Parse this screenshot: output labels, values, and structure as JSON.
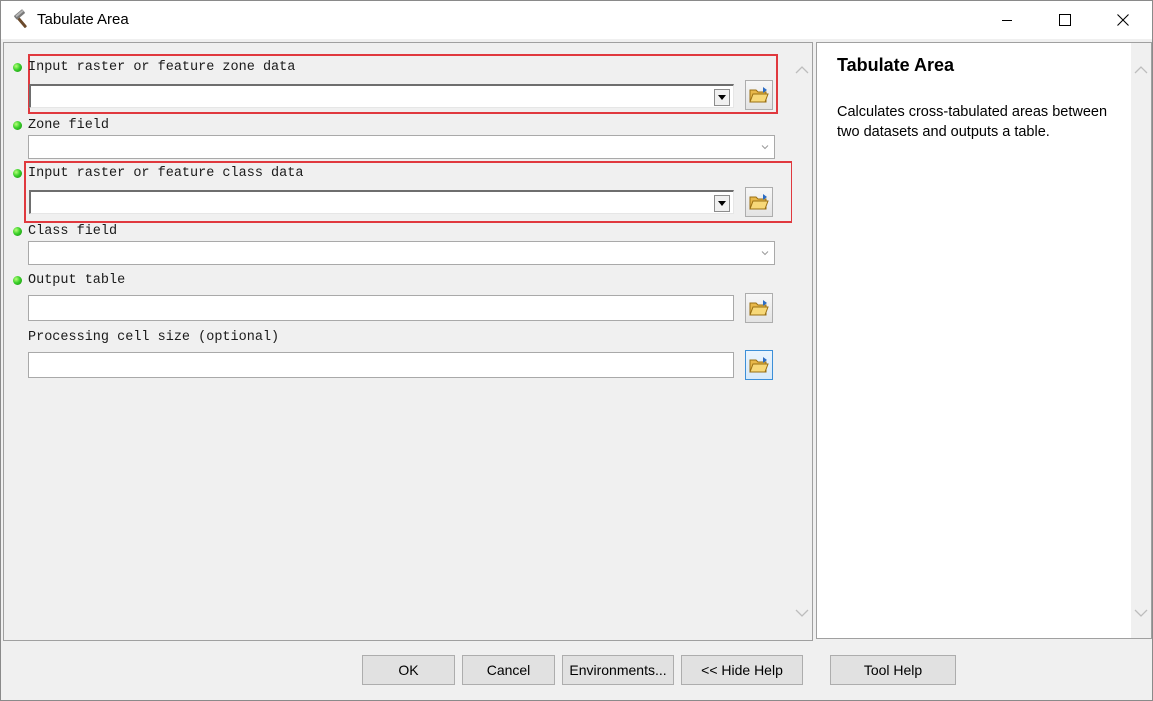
{
  "window": {
    "title": "Tabulate Area",
    "controls": [
      "minimize-icon",
      "maximize-icon",
      "close-icon"
    ]
  },
  "params": {
    "zone_data": {
      "label": "Input raster or feature zone data",
      "value": "",
      "required": true
    },
    "zone_field": {
      "label": "Zone field",
      "value": "",
      "required": true
    },
    "class_data": {
      "label": "Input raster or feature class data",
      "value": "",
      "required": true
    },
    "class_field": {
      "label": "Class field",
      "value": "",
      "required": true
    },
    "output_table": {
      "label": "Output table",
      "value": "",
      "required": true
    },
    "cell_size": {
      "label": "Processing cell size (optional)",
      "value": "",
      "required": false
    }
  },
  "help": {
    "title": "Tabulate Area",
    "body": "Calculates cross-tabulated areas between two datasets and outputs a table."
  },
  "buttons": {
    "ok": "OK",
    "cancel": "Cancel",
    "environments": "Environments...",
    "hide_help": "<< Hide Help",
    "tool_help": "Tool Help"
  },
  "colors": {
    "highlight": "#e0393e",
    "required_dot": "#3ad12a",
    "focus_border": "#3c8fd8"
  }
}
